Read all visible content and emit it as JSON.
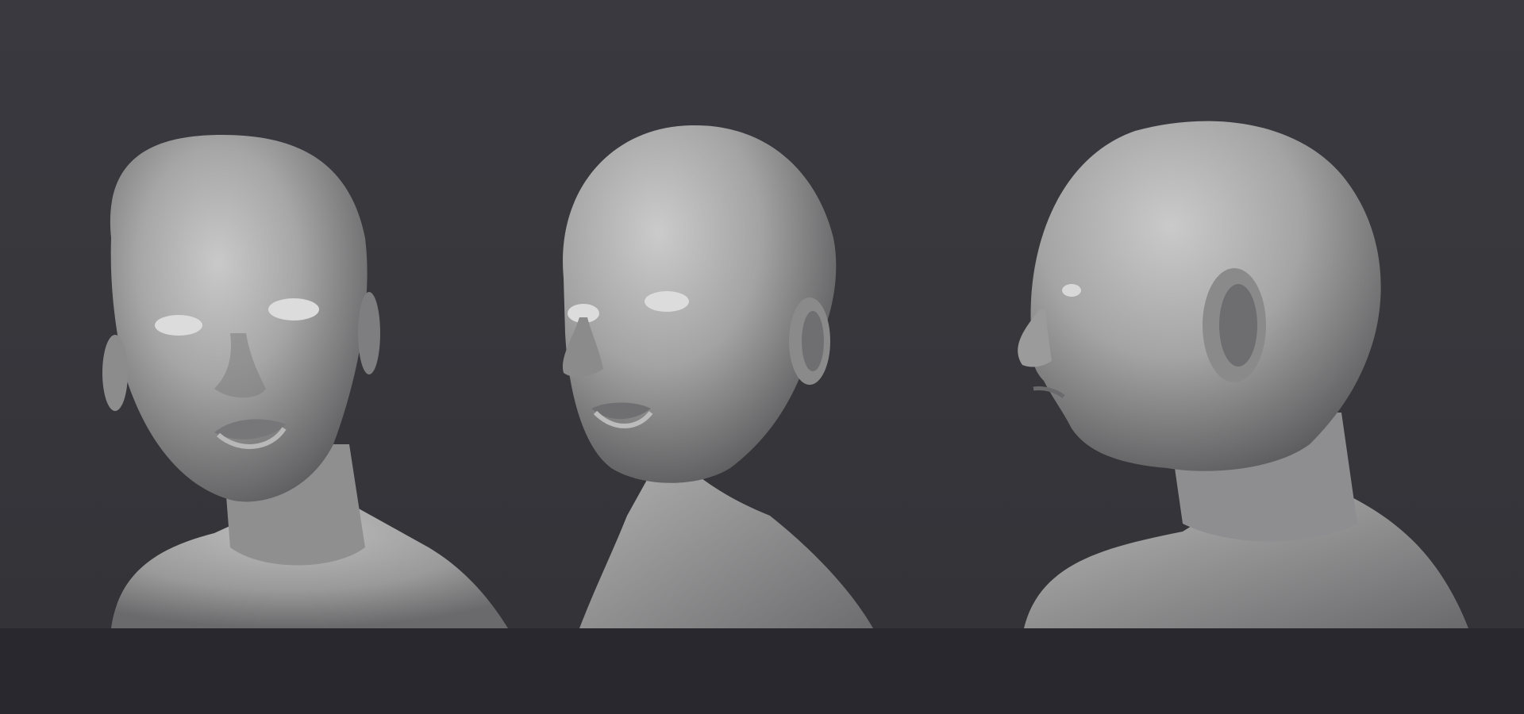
{
  "scene": {
    "background_color": "#37373c",
    "floor_color": "#29282e",
    "clay_color": "#9a9a9a",
    "views": [
      {
        "id": "front",
        "icon": "bald-head-front-view"
      },
      {
        "id": "three-quarter",
        "icon": "bald-head-three-quarter-view"
      },
      {
        "id": "profile",
        "icon": "bald-head-profile-view"
      }
    ]
  }
}
